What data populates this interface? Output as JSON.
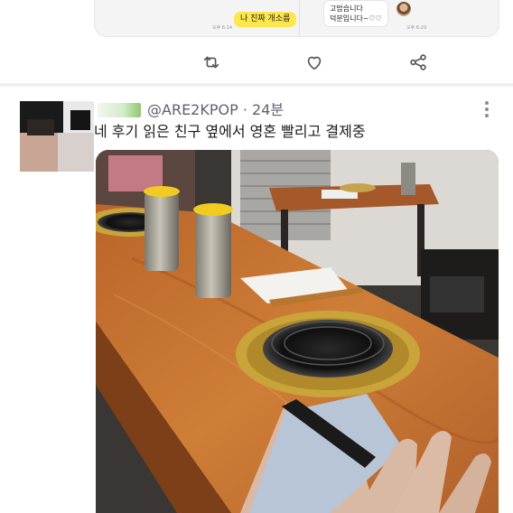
{
  "quoted_chat": {
    "left_bubble": "나 진짜 개소름",
    "left_time": "오후 6:14",
    "right_bubble_line1": "고맙습니다",
    "right_bubble_line2": "덕분입니다~♡♡",
    "right_time": "오후 6:29"
  },
  "actions": [
    {
      "name": "retweet-icon"
    },
    {
      "name": "heart-icon"
    },
    {
      "name": "share-icon"
    }
  ],
  "tweet": {
    "handle": "@ARE2KPOP",
    "separator": "·",
    "time": "24분",
    "text": "네 후기 읽은 친구 옆에서 영혼 빨리고 결제중"
  },
  "colors": {
    "chat_yellow": "#fde74c",
    "handle_gray": "#5b6470",
    "table_wood": "#c7742f",
    "brass": "#c9a43a"
  }
}
